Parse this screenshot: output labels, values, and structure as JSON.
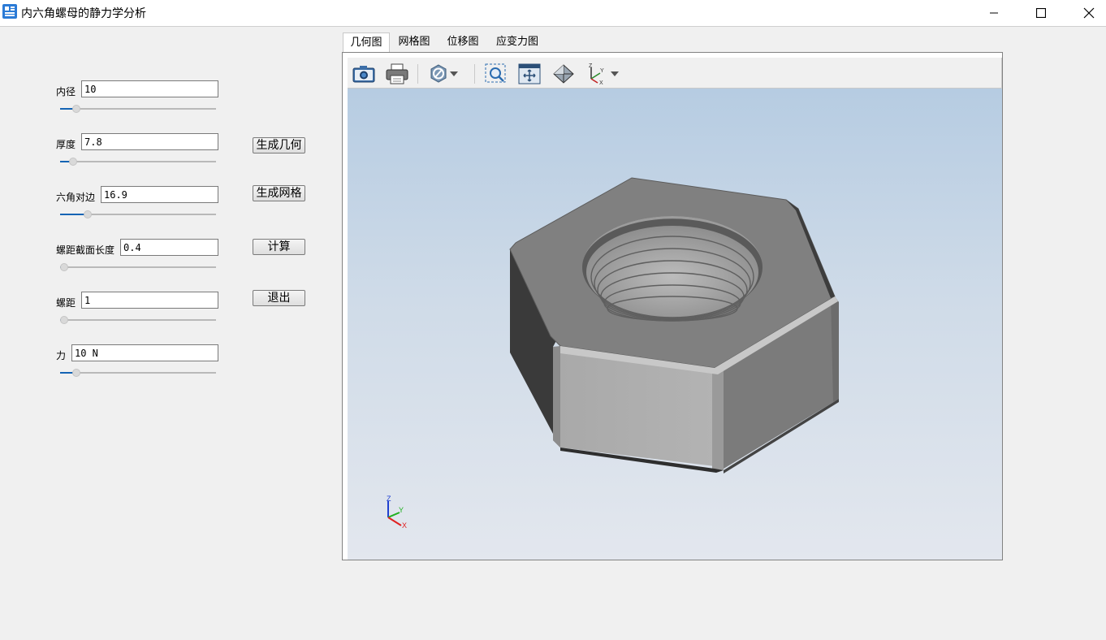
{
  "window": {
    "title": "内六角螺母的静力学分析"
  },
  "fields": [
    {
      "label": "内径",
      "value": "10",
      "slider_fraction": 0.08
    },
    {
      "label": "厚度",
      "value": "7.8",
      "slider_fraction": 0.06
    },
    {
      "label": "六角对边",
      "value": "16.9",
      "slider_fraction": 0.16
    },
    {
      "label": "螺距截面长度",
      "value": "0.4",
      "slider_fraction": 0.0
    },
    {
      "label": "螺距",
      "value": "1",
      "slider_fraction": 0.0
    },
    {
      "label": "力",
      "value": "10 N",
      "slider_fraction": 0.08
    }
  ],
  "buttons": {
    "generate_geometry": "生成几何",
    "generate_mesh": "生成网格",
    "compute": "计算",
    "exit": "退出"
  },
  "tabs": [
    {
      "label": "几何图",
      "active": true
    },
    {
      "label": "网格图",
      "active": false
    },
    {
      "label": "位移图",
      "active": false
    },
    {
      "label": "应变力图",
      "active": false
    }
  ],
  "toolbar": {
    "icons": [
      "camera-icon",
      "print-icon",
      "display-mode-icon",
      "zoom-window-icon",
      "fit-all-icon",
      "view-diamond-icon",
      "axes-view-icon"
    ]
  },
  "triad": {
    "z": "Z",
    "y": "Y",
    "x": "X"
  },
  "colors": {
    "accent": "#1464b4",
    "viewer_bg_top": "#b6cce2",
    "viewer_bg_bottom": "#e3e7ee",
    "triad_x": "#e02020",
    "triad_y": "#20b020",
    "triad_z": "#2040d0"
  }
}
